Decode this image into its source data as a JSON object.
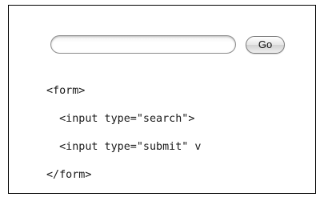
{
  "form": {
    "search_value": "",
    "button_label": "Go"
  },
  "code": {
    "lines": [
      "<form>",
      "  <input type=\"search\">",
      "  <input type=\"submit\" v",
      "</form>"
    ]
  }
}
